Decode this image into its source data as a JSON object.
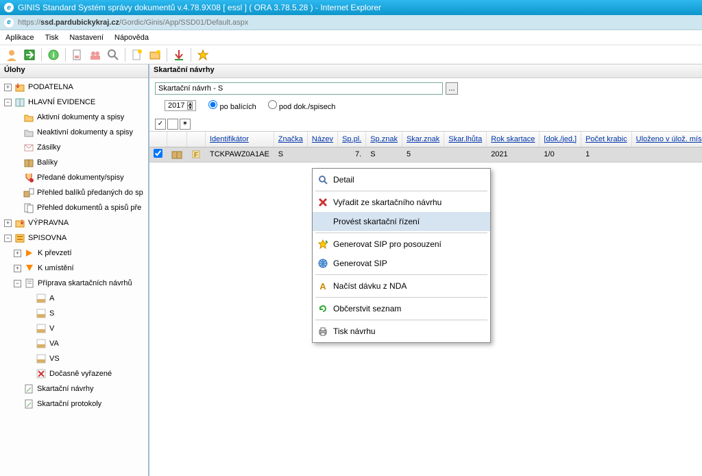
{
  "window": {
    "title": "GINIS Standard Systém správy dokumentů v.4.78.9X08 [ essl ] ( ORA 3.78.5.28 ) - Internet Explorer",
    "url_prefix": "https://",
    "url_host": "ssd.pardubickykraj.cz",
    "url_path": "/Gordic/Ginis/App/SSD01/Default.aspx"
  },
  "menu": {
    "items": [
      "Aplikace",
      "Tisk",
      "Nastavení",
      "Nápověda"
    ]
  },
  "sidebar": {
    "header": "Úlohy",
    "nodes": [
      {
        "level": 0,
        "expand": "+",
        "icon": "podatelna",
        "label": "PODATELNA"
      },
      {
        "level": 0,
        "expand": "-",
        "icon": "book",
        "label": "HLAVNÍ EVIDENCE"
      },
      {
        "level": 1,
        "icon": "folder",
        "label": "Aktivní dokumenty a spisy"
      },
      {
        "level": 1,
        "icon": "folder-grey",
        "label": "Neaktivní dokumenty a spisy"
      },
      {
        "level": 1,
        "icon": "envelope",
        "label": "Zásilky"
      },
      {
        "level": 1,
        "icon": "package",
        "label": "Balíky"
      },
      {
        "level": 1,
        "icon": "hand-down",
        "label": "Předané dokumenty/spisy"
      },
      {
        "level": 1,
        "icon": "box-list",
        "label": "Přehled balíků předaných do sp"
      },
      {
        "level": 1,
        "icon": "doc-list",
        "label": "Přehled dokumentů a spisů pře"
      },
      {
        "level": 0,
        "expand": "+",
        "icon": "vypravna",
        "label": "VÝPRAVNA"
      },
      {
        "level": 0,
        "expand": "-",
        "icon": "spisovna",
        "label": "SPISOVNA"
      },
      {
        "level": 1,
        "expand": "+",
        "icon": "arrow-orange",
        "label": "K převzetí",
        "expandable": true
      },
      {
        "level": 1,
        "expand": "+",
        "icon": "arrow-orange-down",
        "label": "K umístění",
        "expandable": true
      },
      {
        "level": 1,
        "expand": "-",
        "icon": "doc-prep",
        "label": "Příprava skartačních návrhů",
        "expandable": true
      },
      {
        "level": 2,
        "icon": "letter",
        "label": "A"
      },
      {
        "level": 2,
        "icon": "letter",
        "label": "S"
      },
      {
        "level": 2,
        "icon": "letter",
        "label": "V"
      },
      {
        "level": 2,
        "icon": "letter",
        "label": "VA"
      },
      {
        "level": 2,
        "icon": "letter",
        "label": "VS"
      },
      {
        "level": 2,
        "icon": "letter-x",
        "label": "Dočasně vyřazené"
      },
      {
        "level": 1,
        "icon": "doc",
        "label": "Skartační návrhy"
      },
      {
        "level": 1,
        "icon": "doc",
        "label": "Skartační protokoly"
      }
    ]
  },
  "main": {
    "header": "Skartační návrhy",
    "filter_value": "Skartační návrh - S",
    "year": "2017",
    "radio1": "po balících",
    "radio2": "pod dok./spisech",
    "columns": [
      "",
      "",
      "",
      "Identifikátor",
      "Značka",
      "Název",
      "Sp.pl.",
      "Sp.znak",
      "Skar.znak",
      "Skar.lhůta",
      "Rok skartace",
      "[dok./jed.]",
      "Počet krabic",
      "Uloženo v úlož. mís"
    ],
    "row": {
      "checked": true,
      "ident": "TCKPAWZ0A1AE",
      "znacka": "S",
      "nazev": "",
      "sppl_suffix": "7.",
      "spznak": "S",
      "skarznak": "5",
      "skarlhuta": "",
      "rokskart": "2021",
      "dokjed": "1/0",
      "pocetkrabic": "1",
      "ulozeno": ""
    }
  },
  "context_menu": {
    "items": [
      {
        "icon": "magnify",
        "label": "Detail"
      },
      {
        "icon": "x-red",
        "label": "Vyřadit ze skartačního návrhu",
        "sep_before": true
      },
      {
        "icon": "",
        "label": "Provést skartační řízení",
        "highlight": true
      },
      {
        "icon": "star",
        "label": "Generovat SIP pro posouzení",
        "sep_before": true
      },
      {
        "icon": "globe",
        "label": "Generovat SIP"
      },
      {
        "icon": "letter-a",
        "label": "Načíst dávku z NDA",
        "sep_before": true
      },
      {
        "icon": "refresh",
        "label": "Občerstvit seznam",
        "sep_before": true
      },
      {
        "icon": "printer",
        "label": "Tisk návrhu",
        "sep_before": true
      }
    ]
  }
}
